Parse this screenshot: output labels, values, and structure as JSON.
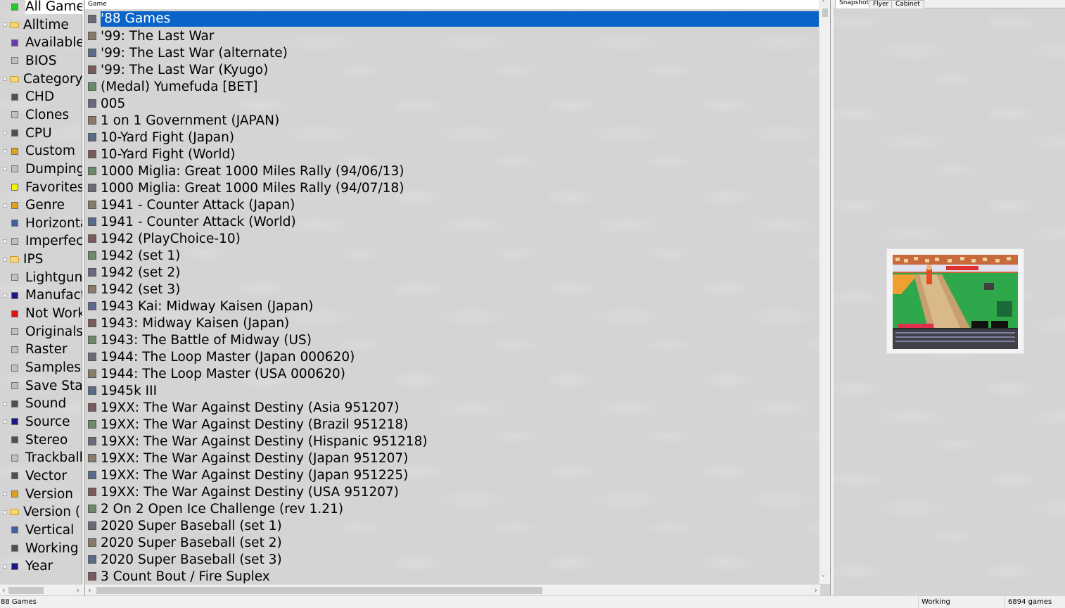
{
  "tree": {
    "items": [
      {
        "label": "All Games",
        "icon": "green-square-icon",
        "color": "#22cc22",
        "expander": false,
        "selected": true
      },
      {
        "label": "Alltime",
        "icon": "folder-icon",
        "color": "#f5d77a",
        "expander": true
      },
      {
        "label": "Available",
        "icon": "purple-square-icon",
        "color": "#6a3ea8",
        "expander": false
      },
      {
        "label": "BIOS",
        "icon": "gray-square-icon",
        "color": "#c0c0c0",
        "expander": false
      },
      {
        "label": "Category",
        "icon": "folder-icon",
        "color": "#f5d77a",
        "expander": true
      },
      {
        "label": "CHD",
        "icon": "dark-square-icon",
        "color": "#505050",
        "expander": false
      },
      {
        "label": "Clones",
        "icon": "gray-square-icon",
        "color": "#c0c0c0",
        "expander": false
      },
      {
        "label": "CPU",
        "icon": "dark-square-icon",
        "color": "#505050",
        "expander": true
      },
      {
        "label": "Custom",
        "icon": "orange-square-icon",
        "color": "#e0a020",
        "expander": true
      },
      {
        "label": "Dumping",
        "icon": "gray-square-icon",
        "color": "#c0c0c0",
        "expander": true
      },
      {
        "label": "Favorites",
        "icon": "yellow-square-icon",
        "color": "#f4f400",
        "expander": false
      },
      {
        "label": "Genre",
        "icon": "orange-square-icon",
        "color": "#e0a020",
        "expander": true
      },
      {
        "label": "Horizontal",
        "icon": "blue-square-icon",
        "color": "#4060a0",
        "expander": false
      },
      {
        "label": "Imperfect",
        "icon": "gray-square-icon",
        "color": "#c0c0c0",
        "expander": true
      },
      {
        "label": "IPS",
        "icon": "folder-icon",
        "color": "#f5d77a",
        "expander": true
      },
      {
        "label": "Lightgun",
        "icon": "gray-square-icon",
        "color": "#c0c0c0",
        "expander": false
      },
      {
        "label": "Manufacturer",
        "icon": "navy-square-icon",
        "color": "#1a1a8a",
        "expander": true
      },
      {
        "label": "Not Working",
        "icon": "red-square-icon",
        "color": "#e01010",
        "expander": false
      },
      {
        "label": "Originals",
        "icon": "gray-square-icon",
        "color": "#c0c0c0",
        "expander": false
      },
      {
        "label": "Raster",
        "icon": "gray-square-icon",
        "color": "#c0c0c0",
        "expander": false
      },
      {
        "label": "Samples",
        "icon": "gray-square-icon",
        "color": "#c0c0c0",
        "expander": false
      },
      {
        "label": "Save State",
        "icon": "gray-square-icon",
        "color": "#c0c0c0",
        "expander": false
      },
      {
        "label": "Sound",
        "icon": "dark-square-icon",
        "color": "#505050",
        "expander": true
      },
      {
        "label": "Source",
        "icon": "navy-square-icon",
        "color": "#1a1a8a",
        "expander": true
      },
      {
        "label": "Stereo",
        "icon": "dark-square-icon",
        "color": "#505050",
        "expander": false
      },
      {
        "label": "Trackball",
        "icon": "gray-square-icon",
        "color": "#c0c0c0",
        "expander": false
      },
      {
        "label": "Vector",
        "icon": "dark-square-icon",
        "color": "#505050",
        "expander": false
      },
      {
        "label": "Version",
        "icon": "orange-square-icon",
        "color": "#e0a020",
        "expander": true
      },
      {
        "label": "Version (",
        "icon": "folder-icon",
        "color": "#f5d77a",
        "expander": true
      },
      {
        "label": "Vertical",
        "icon": "blue-square-icon",
        "color": "#4060a0",
        "expander": false
      },
      {
        "label": "Working",
        "icon": "dark-square-icon",
        "color": "#505050",
        "expander": false
      },
      {
        "label": "Year",
        "icon": "navy-square-icon",
        "color": "#1a1a8a",
        "expander": true
      }
    ]
  },
  "list": {
    "column_header": "Game",
    "games": [
      {
        "title": "'88 Games",
        "selected": true
      },
      {
        "title": "'99: The Last War"
      },
      {
        "title": "'99: The Last War (alternate)"
      },
      {
        "title": "'99: The Last War (Kyugo)"
      },
      {
        "title": "(Medal) Yumefuda [BET]"
      },
      {
        "title": "005"
      },
      {
        "title": "1 on 1 Government (JAPAN)"
      },
      {
        "title": "10-Yard Fight (Japan)"
      },
      {
        "title": "10-Yard Fight (World)"
      },
      {
        "title": "1000 Miglia: Great 1000 Miles Rally (94/06/13)"
      },
      {
        "title": "1000 Miglia: Great 1000 Miles Rally (94/07/18)"
      },
      {
        "title": "1941 - Counter Attack (Japan)"
      },
      {
        "title": "1941 - Counter Attack (World)"
      },
      {
        "title": "1942 (PlayChoice-10)"
      },
      {
        "title": "1942 (set 1)"
      },
      {
        "title": "1942 (set 2)"
      },
      {
        "title": "1942 (set 3)"
      },
      {
        "title": "1943 Kai: Midway Kaisen (Japan)"
      },
      {
        "title": "1943: Midway Kaisen (Japan)"
      },
      {
        "title": "1943: The Battle of Midway (US)"
      },
      {
        "title": "1944: The Loop Master (Japan 000620)"
      },
      {
        "title": "1944: The Loop Master (USA 000620)"
      },
      {
        "title": "1945k III"
      },
      {
        "title": "19XX: The War Against Destiny (Asia 951207)"
      },
      {
        "title": "19XX: The War Against Destiny (Brazil 951218)"
      },
      {
        "title": "19XX: The War Against Destiny (Hispanic 951218)"
      },
      {
        "title": "19XX: The War Against Destiny (Japan 951207)"
      },
      {
        "title": "19XX: The War Against Destiny (Japan 951225)"
      },
      {
        "title": "19XX: The War Against Destiny (USA 951207)"
      },
      {
        "title": "2 On 2 Open Ice Challenge (rev 1.21)"
      },
      {
        "title": "2020 Super Baseball (set 1)"
      },
      {
        "title": "2020 Super Baseball (set 2)"
      },
      {
        "title": "2020 Super Baseball (set 3)"
      },
      {
        "title": "3 Count Bout / Fire Suplex"
      }
    ]
  },
  "right": {
    "tabs": [
      "Snapshot",
      "Flyer",
      "Cabinet"
    ],
    "active_tab": "Snapshot"
  },
  "status": {
    "selected": "88 Games",
    "state": "Working",
    "count": "6894 games"
  },
  "colors": {
    "selection": "#0a64c8",
    "panel_bg": "#d4d4d4"
  }
}
